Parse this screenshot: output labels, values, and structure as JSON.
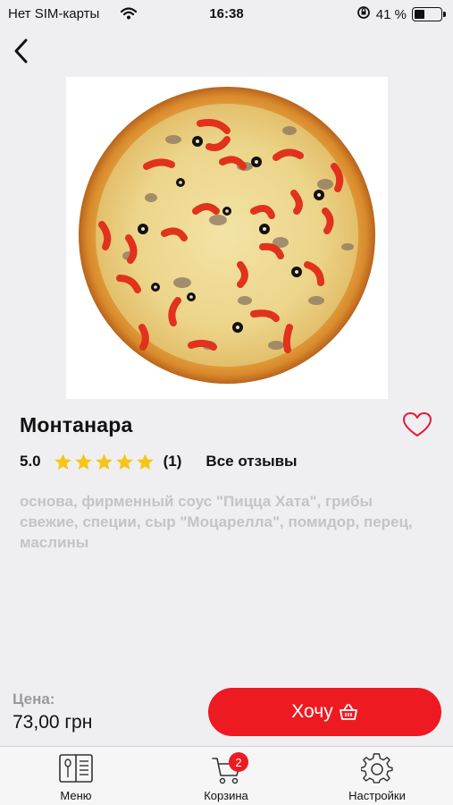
{
  "status_bar": {
    "carrier": "Нет SIM-карты",
    "time": "16:38",
    "battery_percent": "41 %",
    "battery_level": 0.41
  },
  "product": {
    "name": "Монтанара",
    "rating": "5.0",
    "stars_filled": 5,
    "review_count": "(1)",
    "all_reviews_label": "Все отзывы",
    "description": "основа, фирменный соус \"Пицца Хата\", грибы свежие, специи, сыр \"Моцарелла\", помидор, перец, маслины",
    "image_icon": "pizza-photo"
  },
  "price": {
    "label": "Цена:",
    "value": "73,00 грн"
  },
  "actions": {
    "want_label": "Хочу"
  },
  "tab_bar": {
    "menu_label": "Меню",
    "cart_label": "Корзина",
    "cart_badge": "2",
    "settings_label": "Настройки"
  },
  "colors": {
    "accent": "#ee1a22",
    "star": "#f5c518",
    "description": "#c4c4c7",
    "background": "#efeff1"
  }
}
